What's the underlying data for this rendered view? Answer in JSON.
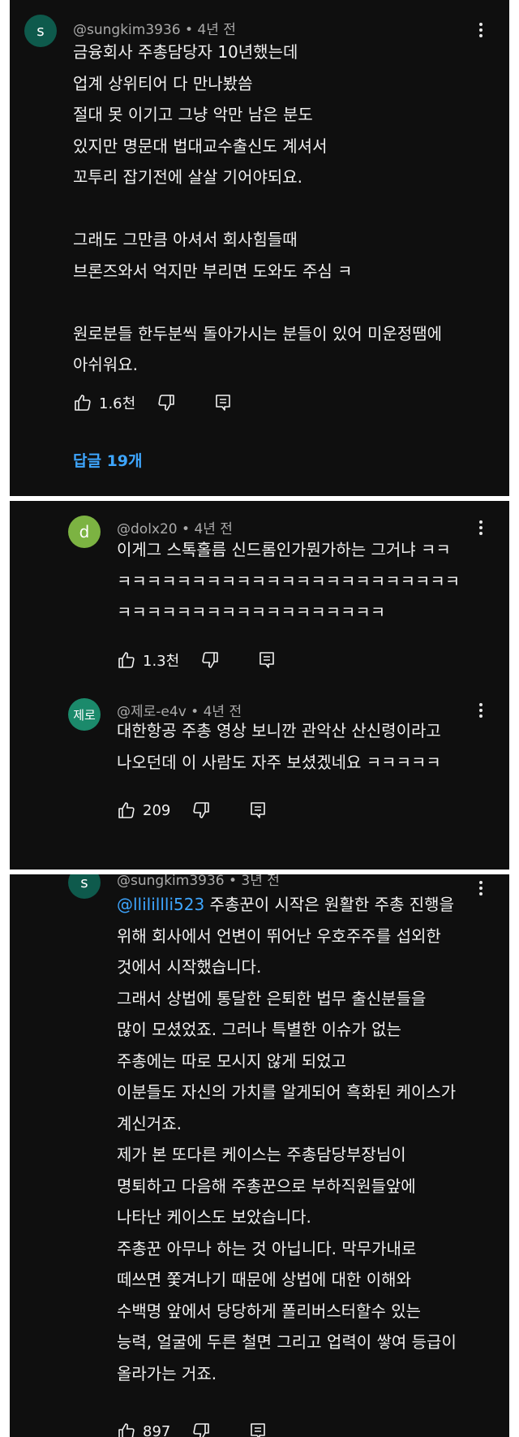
{
  "comments": [
    {
      "avatar_letter": "s",
      "handle": "@sungkim3936",
      "time": " • 4년 전",
      "lines": [
        "금융회사 주총담당자 10년했는데",
        "업계 상위티어 다 만나봤씀",
        "절대 못 이기고 그냥 악만 남은 분도",
        "있지만 명문대 법대교수출신도 계셔서",
        "꼬투리 잡기전에 살살 기어야되요.",
        "",
        "그래도 그만큼 아셔서 회사힘들때",
        "브론즈와서 억지만 부리면 도와도 주심 ㅋ",
        "",
        "원로분들 한두분씩 돌아가시는 분들이 있어 미운정땜에",
        "아쉬워요."
      ],
      "likes": "1.6천",
      "replies_label": "답글 19개"
    },
    {
      "avatar_letter": "d",
      "handle": "@dolx20",
      "time": " • 4년 전",
      "lines": [
        "이게그 스톡홀름 신드롬인가뭔가하는 그거냐 ㅋㅋ",
        "ㅋㅋㅋㅋㅋㅋㅋㅋㅋㅋㅋㅋㅋㅋㅋㅋㅋㅋㅋㅋㅋㅋㅋ",
        "ㅋㅋㅋㅋㅋㅋㅋㅋㅋㅋㅋㅋㅋㅋㅋㅋㅋㅋ"
      ],
      "likes": "1.3천"
    },
    {
      "avatar_letter": "제로",
      "handle": "@제로-e4v",
      "time": " • 4년 전",
      "lines": [
        "대한항공 주총 영상 보니깐 관악산 산신령이라고",
        "나오던데 이 사람도 자주 보셨겠네요 ㅋㅋㅋㅋㅋ"
      ],
      "likes": "209"
    },
    {
      "avatar_letter": "s",
      "handle": "@sungkim3936",
      "time": " • 3년 전",
      "mention": "@llilillli523",
      "first_line_rest": " 주총꾼이 시작은 원활한 주총 진행을",
      "lines": [
        "위해 회사에서 언변이 뛰어난 우호주주를 섭외한",
        "것에서 시작했습니다.",
        "그래서 상법에 통달한 은퇴한 법무 출신분들을",
        "많이 모셨었죠. 그러나 특별한 이슈가 없는",
        "주총에는 따로 모시지 않게 되었고",
        "이분들도 자신의 가치를 알게되어 흑화된 케이스가",
        "계신거죠.",
        "제가 본 또다른 케이스는 주총담당부장님이",
        "명퇴하고 다음해 주총꾼으로 부하직원들앞에",
        "나타난 케이스도 보았습니다.",
        "주총꾼 아무나 하는 것 아닙니다. 막무가내로",
        "떼쓰면 쫓겨나기 때문에 상법에 대한 이해와",
        "수백명 앞에서 당당하게 폴리버스터할수 있는",
        "능력, 얼굴에 두른 철면 그리고 업력이 쌓여 등급이",
        "올라가는 거죠."
      ],
      "likes": "897"
    }
  ],
  "icons": {
    "like": "thumbs-up-icon",
    "dislike": "thumbs-down-icon",
    "reply": "reply-comment-icon",
    "more": "more-vertical-icon"
  },
  "colors": {
    "background": "#0f0f0f",
    "link": "#3ea6ff",
    "meta": "#aaaaaa"
  }
}
